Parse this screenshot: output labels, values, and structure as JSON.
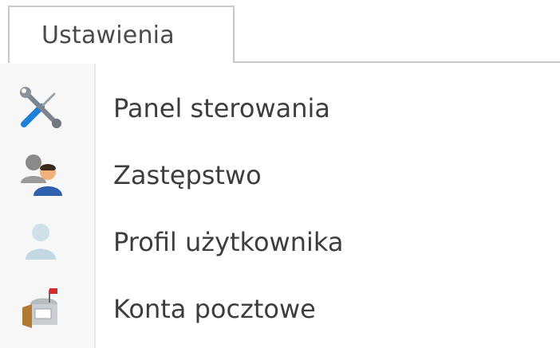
{
  "tab": {
    "label": "Ustawienia"
  },
  "menu": {
    "items": [
      {
        "label": "Panel sterowania",
        "icon": "tools-icon"
      },
      {
        "label": "Zastępstwo",
        "icon": "users-substitute-icon"
      },
      {
        "label": "Profil użytkownika",
        "icon": "user-profile-icon"
      },
      {
        "label": "Konta pocztowe",
        "icon": "mailbox-icon"
      }
    ]
  },
  "colors": {
    "border": "#c8c8c8",
    "text": "#3d3d3d",
    "icon_column": "#f7f7f7"
  }
}
